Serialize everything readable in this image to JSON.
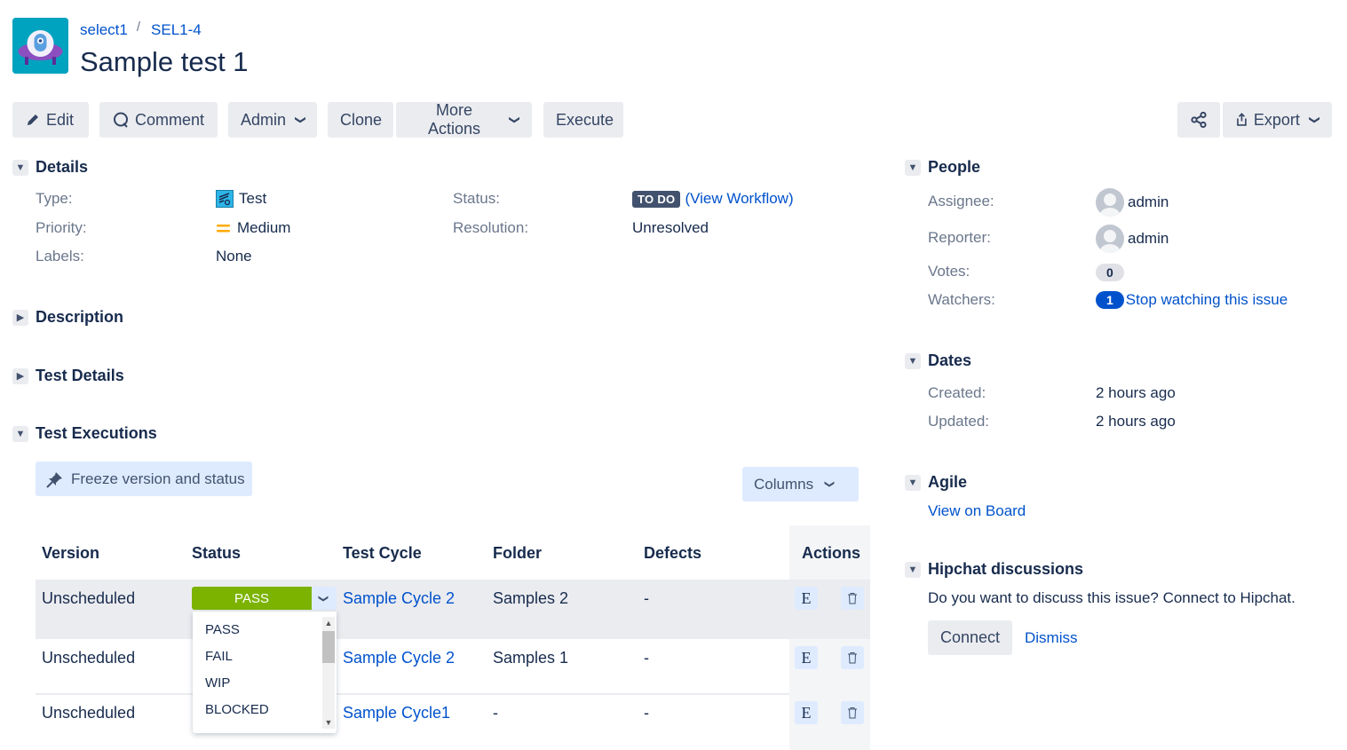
{
  "header": {
    "project_avatar": "ufo-project-avatar",
    "breadcrumb": {
      "project": "select1",
      "separator": "/",
      "issue_key": "SEL1-4"
    },
    "title": "Sample test 1"
  },
  "toolbar": {
    "edit": "Edit",
    "comment": "Comment",
    "admin": "Admin",
    "clone": "Clone",
    "more_actions": "More Actions",
    "execute": "Execute",
    "export": "Export"
  },
  "details": {
    "heading": "Details",
    "type_label": "Type:",
    "type_value": "Test",
    "priority_label": "Priority:",
    "priority_value": "Medium",
    "labels_label": "Labels:",
    "labels_value": "None",
    "status_label": "Status:",
    "status_value": "TO DO",
    "view_workflow": "(View Workflow)",
    "resolution_label": "Resolution:",
    "resolution_value": "Unresolved"
  },
  "sections": {
    "description": "Description",
    "test_details": "Test Details",
    "test_executions": "Test Executions"
  },
  "executions": {
    "freeze_button": "Freeze version and status",
    "columns_button": "Columns",
    "headers": [
      "Version",
      "Status",
      "Test Cycle",
      "Folder",
      "Defects",
      "Actions"
    ],
    "rows": [
      {
        "version": "Unscheduled",
        "status": "PASS",
        "cycle": "Sample Cycle 2",
        "folder": "Samples 2",
        "defects": "-"
      },
      {
        "version": "Unscheduled",
        "status": "",
        "cycle": "Sample Cycle 2",
        "folder": "Samples 1",
        "defects": "-"
      },
      {
        "version": "Unscheduled",
        "status": "",
        "cycle": "Sample Cycle1",
        "folder": "-",
        "defects": "-"
      }
    ],
    "status_options": [
      "PASS",
      "FAIL",
      "WIP",
      "BLOCKED"
    ],
    "pass_color": "#7bb300",
    "execute_action": "E"
  },
  "people": {
    "heading": "People",
    "assignee_label": "Assignee:",
    "assignee": "admin",
    "reporter_label": "Reporter:",
    "reporter": "admin",
    "votes_label": "Votes:",
    "votes": "0",
    "watchers_label": "Watchers:",
    "watchers": "1",
    "watch_link": "Stop watching this issue"
  },
  "dates": {
    "heading": "Dates",
    "created_label": "Created:",
    "created": "2 hours ago",
    "updated_label": "Updated:",
    "updated": "2 hours ago"
  },
  "agile": {
    "heading": "Agile",
    "view_on_board": "View on Board"
  },
  "hipchat": {
    "heading": "Hipchat discussions",
    "message": "Do you want to discuss this issue? Connect to Hipchat.",
    "connect": "Connect",
    "dismiss": "Dismiss"
  }
}
